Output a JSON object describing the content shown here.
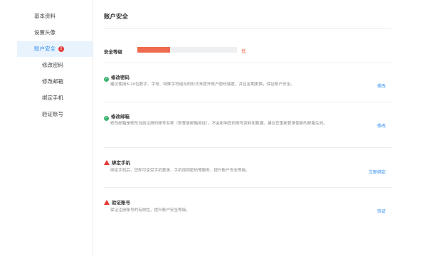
{
  "sidebar": {
    "items": [
      {
        "label": "基本资料"
      },
      {
        "label": "设置头像"
      },
      {
        "label": "账户安全",
        "alert": "!"
      },
      {
        "label": "修改密码"
      },
      {
        "label": "修改邮箱"
      },
      {
        "label": "绑定手机"
      },
      {
        "label": "验证账号"
      }
    ]
  },
  "main": {
    "title": "账户安全",
    "security_level": {
      "label": "安全等级",
      "value": "低",
      "progress": 0.33
    },
    "rows": [
      {
        "status": "ok",
        "title": "修改密码",
        "desc": "建议使用8-20位数字、字母、特殊字符组合的形式来提升账户密码强度，并且定期更换，保证账户安全。",
        "action": "修改"
      },
      {
        "status": "ok",
        "title": "修改邮箱",
        "desc": "修改邮箱是修改当前注册的账号名称（即登录邮箱地址），不会影响您的账号资料和数据。建议您重新登录使新的邮箱生效。",
        "action": "修改"
      },
      {
        "status": "warn",
        "title": "绑定手机",
        "desc": "绑定手机后，您即可享受手机登录、手机找回密码等服务，提升账户安全等级。",
        "action": "立即绑定"
      },
      {
        "status": "warn",
        "title": "验证账号",
        "desc": "保证注册账号的有效性，提升账户安全等级。",
        "action": "验证"
      }
    ]
  },
  "colors": {
    "accent": "#2d8cf0",
    "danger": "#e53935",
    "ok": "#3cb371",
    "level": "#ef6a4e"
  }
}
